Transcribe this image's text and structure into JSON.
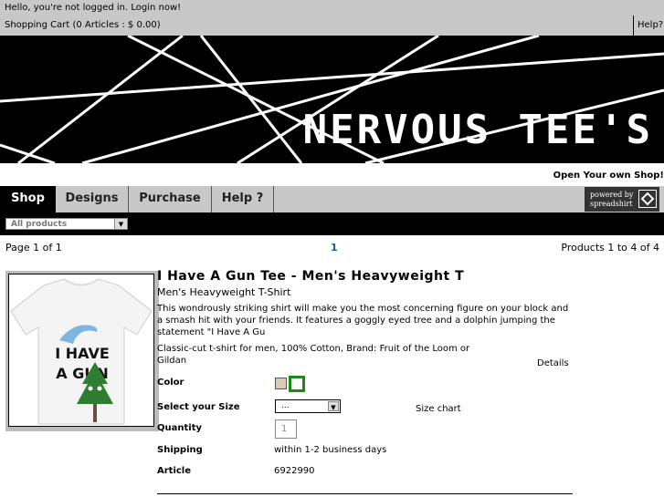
{
  "topbar": {
    "hello": "Hello, you're not logged in. Login now!",
    "cart": "Shopping Cart  (0 Articles : $ 0.00)",
    "help": "Help?"
  },
  "banner": {
    "title": "NERVOUS TEE'S"
  },
  "open_shop": "Open Your own Shop!",
  "nav": {
    "tabs": [
      {
        "label": "Shop",
        "active": true
      },
      {
        "label": "Designs"
      },
      {
        "label": "Purchase"
      },
      {
        "label": "Help ?"
      }
    ],
    "powered_line1": "powered by",
    "powered_line2": "spreadshirt"
  },
  "filter": {
    "selected": "All products"
  },
  "pager": {
    "page_text": "Page 1 of 1",
    "current": "1",
    "products_text": "Products 1 to 4 of 4"
  },
  "product": {
    "title": "I Have A Gun Tee - Men's Heavyweight T",
    "subtitle": "Men's Heavyweight T-Shirt",
    "description": "This wondrously striking shirt will make you the most concerning figure on your block and a smash hit with your friends. It features a goggly eyed tree and a dolphin jumping the statement \"I Have A Gu",
    "details_text": "Classic-cut t-shirt for men, 100% Cotton, Brand: Fruit of the Loom or Gildan",
    "details_link": "Details",
    "shirt_print": {
      "line1": "I HAVE",
      "line2": "A GUN"
    },
    "color_label": "Color",
    "colors": [
      "#d8cdb0",
      "#ffffff"
    ],
    "size_label": "Select your Size",
    "size_value": "...",
    "size_chart": "Size chart",
    "quantity_label": "Quantity",
    "quantity_value": "1",
    "shipping_label": "Shipping",
    "shipping_value": "within 1-2 business days",
    "article_label": "Article",
    "article_value": "6922990"
  }
}
